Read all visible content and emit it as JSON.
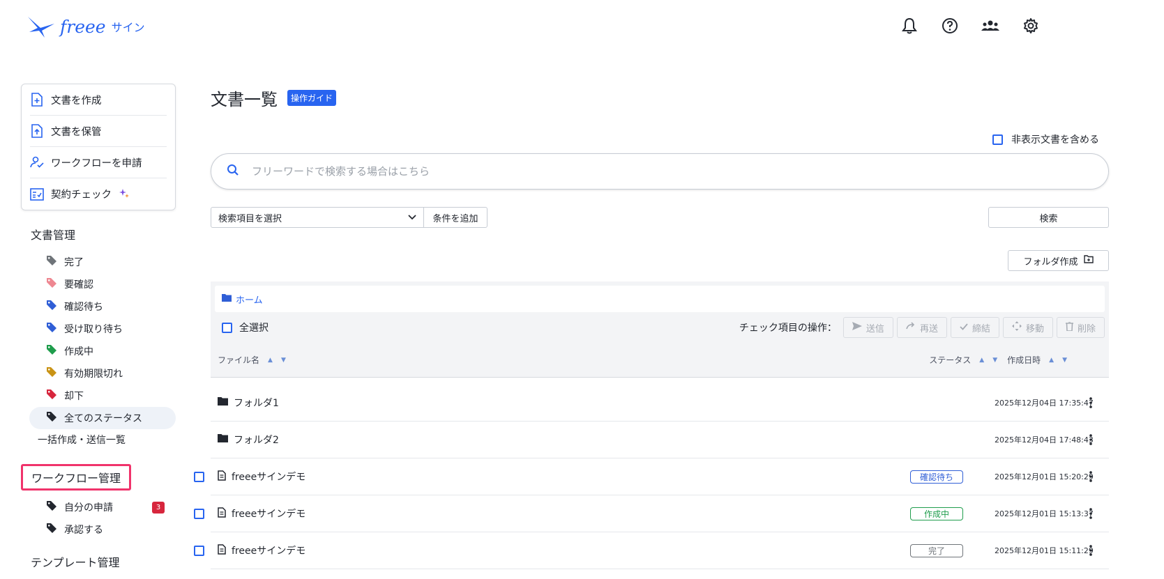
{
  "header": {
    "logo_text": "freee",
    "logo_sub": "サイン",
    "icons": [
      "bell-icon",
      "help-icon",
      "team-icon",
      "gear-icon"
    ]
  },
  "sidebar": {
    "actions": [
      {
        "label": "文書を作成",
        "icon": "file-plus-icon"
      },
      {
        "label": "文書を保管",
        "icon": "file-upload-icon"
      },
      {
        "label": "ワークフローを申請",
        "icon": "user-check-icon"
      },
      {
        "label": "契約チェック",
        "icon": "checklist-icon"
      }
    ],
    "doc_mgmt_title": "文書管理",
    "doc_statuses": [
      {
        "label": "完了",
        "color": "#6f7479"
      },
      {
        "label": "要確認",
        "color": "#ee8791"
      },
      {
        "label": "確認待ち",
        "color": "#2f5ed6"
      },
      {
        "label": "受け取り待ち",
        "color": "#2f5ed6"
      },
      {
        "label": "作成中",
        "color": "#1f9d4c"
      },
      {
        "label": "有効期限切れ",
        "color": "#c99315"
      },
      {
        "label": "却下",
        "color": "#d7263d"
      },
      {
        "label": "全てのステータス",
        "color": "#23272f"
      }
    ],
    "bulk_label": "一括作成・送信一覧",
    "workflow_title": "ワークフロー管理",
    "workflow_items": [
      {
        "label": "自分の申請",
        "badge": "3"
      },
      {
        "label": "承認する",
        "badge": ""
      }
    ],
    "template_title": "テンプレート管理"
  },
  "main": {
    "title": "文書一覧",
    "guide_label": "操作ガイド",
    "include_hidden_label": "非表示文書を含める",
    "search_placeholder": "フリーワードで検索する場合はこちら",
    "select_label": "検索項目を選択",
    "add_condition_label": "条件を追加",
    "search_button_label": "検索",
    "create_folder_label": "フォルダ作成",
    "breadcrumb_home": "ホーム",
    "select_all_label": "全選択",
    "ops_label": "チェック項目の操作：",
    "ops": [
      {
        "label": "送信",
        "icon": "send-icon"
      },
      {
        "label": "再送",
        "icon": "resend-icon"
      },
      {
        "label": "締結",
        "icon": "check-icon"
      },
      {
        "label": "移動",
        "icon": "move-icon"
      },
      {
        "label": "削除",
        "icon": "trash-icon"
      }
    ],
    "columns": {
      "name": "ファイル名",
      "status": "ステータス",
      "created": "作成日時"
    },
    "rows": [
      {
        "type": "folder",
        "name": "フォルダ1",
        "status": "",
        "status_color": "",
        "date": "2025年12月04日 17:35:47"
      },
      {
        "type": "folder",
        "name": "フォルダ2",
        "status": "",
        "status_color": "",
        "date": "2025年12月04日 17:48:43"
      },
      {
        "type": "file",
        "name": "freeeサインデモ",
        "status": "確認待ち",
        "status_color": "#2f5ed6",
        "date": "2025年12月01日 15:20:29"
      },
      {
        "type": "file",
        "name": "freeeサインデモ",
        "status": "作成中",
        "status_color": "#1f9d4c",
        "date": "2025年12月01日 15:13:37"
      },
      {
        "type": "file",
        "name": "freeeサインデモ",
        "status": "完了",
        "status_color": "#6f7479",
        "date": "2025年12月01日 15:11:29"
      }
    ]
  }
}
